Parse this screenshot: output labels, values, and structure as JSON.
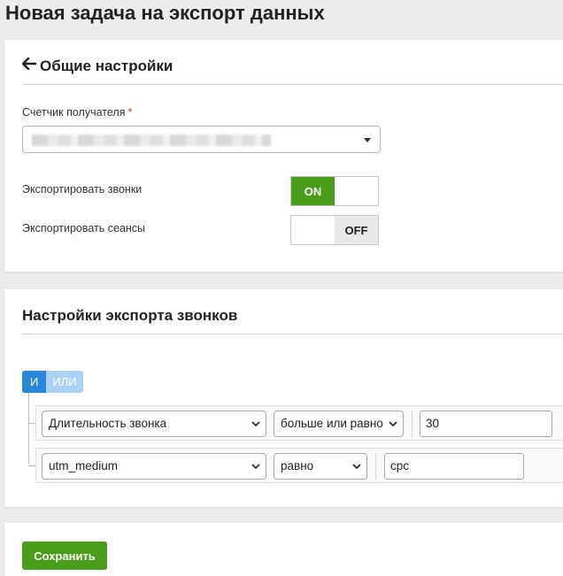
{
  "page": {
    "title": "Новая задача на экспорт данных"
  },
  "general": {
    "heading": "Общие настройки",
    "recipient_label": "Счетчик получателя",
    "required_mark": "*",
    "export_calls_label": "Экспортировать звонки",
    "export_calls_state": "ON",
    "export_sessions_label": "Экспортировать сеансы",
    "export_sessions_state": "OFF"
  },
  "calls": {
    "heading": "Настройки экспорта звонков",
    "logic_and": "И",
    "logic_or": "ИЛИ",
    "conditions": [
      {
        "field": "Длительность звонка",
        "operator": "больше или равно",
        "value": "30"
      },
      {
        "field": "utm_medium",
        "operator": "равно",
        "value": "cpc"
      }
    ]
  },
  "actions": {
    "save_label": "Сохранить"
  },
  "colors": {
    "accent_green": "#4a9d1b",
    "logic_blue": "#2a86d9",
    "logic_light_blue": "#a9d2f4",
    "required_red": "#d9302c"
  }
}
